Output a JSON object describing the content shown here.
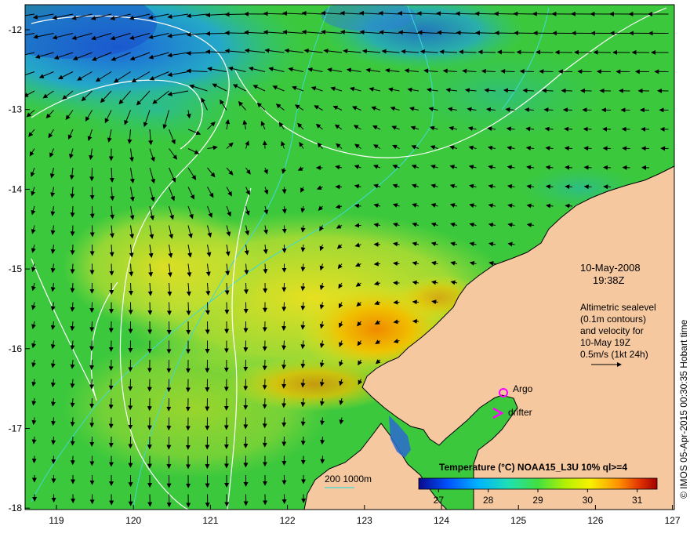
{
  "map": {
    "date_line1": "10-May-2008",
    "date_line2": "19:38Z",
    "altimetry": {
      "line1": "Altimetric sealevel",
      "line2": "(0.1m contours)",
      "line3": "and velocity for",
      "line4": "10-May 19Z",
      "line5": "0.5m/s (1kt 24h)"
    },
    "legend": {
      "argo_label": "Argo",
      "drifter_label": "drifter",
      "marker_color": "#ff00ff"
    },
    "bathymetry_label": "200  1000m",
    "credit": "© IMOS 05-Apr-2015 00:30:35 Hobart time",
    "colorbar": {
      "title": "Temperature (°C) NOAA15_L3U 10% ql>=4",
      "ticks": [
        "27",
        "28",
        "29",
        "30",
        "31"
      ],
      "range": [
        26.6,
        31.4
      ]
    },
    "x_ticks": [
      "119",
      "120",
      "121",
      "122",
      "123",
      "124",
      "125",
      "126",
      "127"
    ],
    "y_ticks": [
      "-12",
      "-13",
      "-14",
      "-15",
      "-16",
      "-17",
      "-18"
    ],
    "colors": {
      "land": "#f6c8a0",
      "ocean_green": "#3ccf3c",
      "warm_yellow": "#e0e020",
      "warm_orange": "#f0a000",
      "cool_blue": "#2aa0d0",
      "contour_white": "#ffffff",
      "bathy_cyan": "#40d8d8"
    }
  }
}
